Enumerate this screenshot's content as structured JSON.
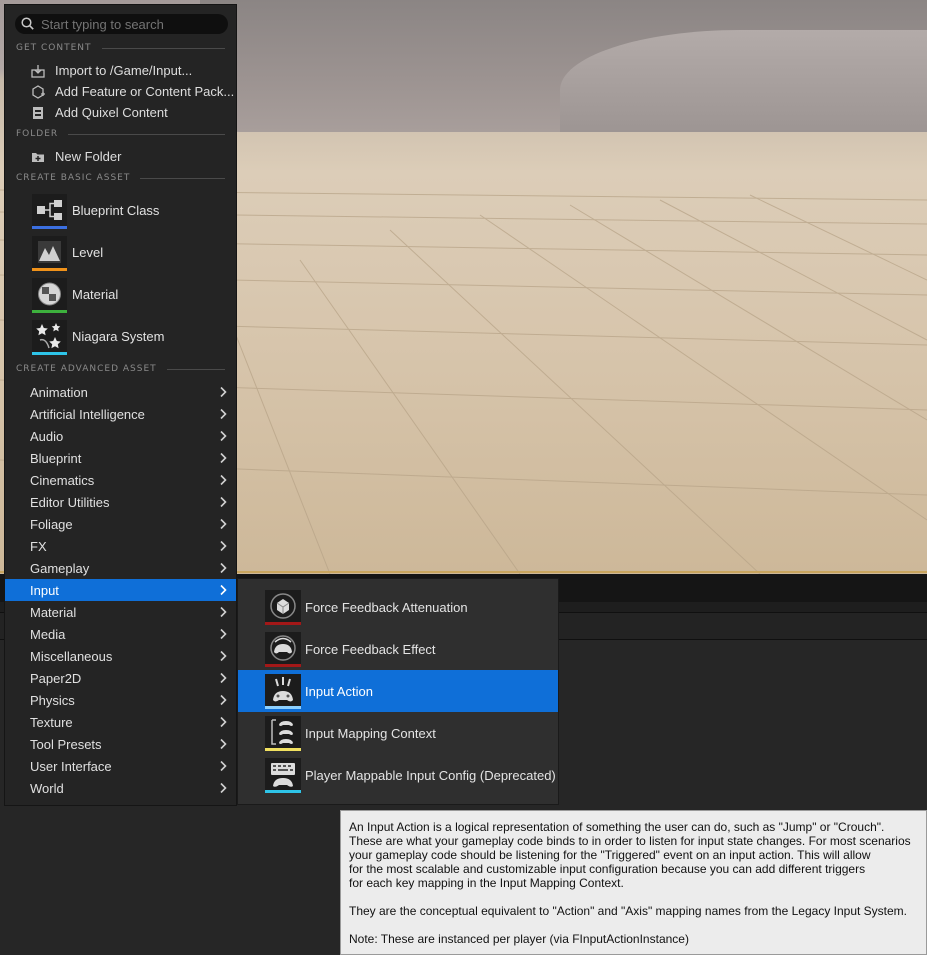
{
  "search": {
    "placeholder": "Start typing to search",
    "icon": "search-icon"
  },
  "sections": {
    "get_content": "GET CONTENT",
    "folder": "FOLDER",
    "create_basic": "CREATE BASIC ASSET",
    "create_advanced": "CREATE ADVANCED ASSET"
  },
  "get_content_items": [
    {
      "label": "Import to /Game/Input...",
      "icon": "import-icon"
    },
    {
      "label": "Add Feature or Content Pack...",
      "icon": "add-feature-icon"
    },
    {
      "label": "Add Quixel Content",
      "icon": "quixel-icon"
    }
  ],
  "folder_items": [
    {
      "label": "New Folder",
      "icon": "new-folder-icon"
    }
  ],
  "basic_assets": [
    {
      "label": "Blueprint Class",
      "icon": "blueprint-class-icon",
      "color": "#3b6fe0"
    },
    {
      "label": "Level",
      "icon": "level-icon",
      "color": "#f0921a"
    },
    {
      "label": "Material",
      "icon": "material-icon",
      "color": "#3db13d"
    },
    {
      "label": "Niagara System",
      "icon": "niagara-icon",
      "color": "#2ec4e8"
    }
  ],
  "categories": [
    "Animation",
    "Artificial Intelligence",
    "Audio",
    "Blueprint",
    "Cinematics",
    "Editor Utilities",
    "Foliage",
    "FX",
    "Gameplay",
    "Input",
    "Material",
    "Media",
    "Miscellaneous",
    "Paper2D",
    "Physics",
    "Texture",
    "Tool Presets",
    "User Interface",
    "World"
  ],
  "active_category": "Input",
  "submenu": [
    {
      "label": "Force Feedback Attenuation",
      "icon": "force-feedback-attenuation-icon",
      "color": "#a31818"
    },
    {
      "label": "Force Feedback Effect",
      "icon": "force-feedback-effect-icon",
      "color": "#a31818"
    },
    {
      "label": "Input Action",
      "icon": "input-action-icon",
      "color": "#8cd0ff"
    },
    {
      "label": "Input Mapping Context",
      "icon": "input-mapping-context-icon",
      "color": "#f0e060"
    },
    {
      "label": "Player Mappable Input Config (Deprecated)",
      "icon": "player-mappable-config-icon",
      "color": "#2ec4e8"
    }
  ],
  "active_submenu": "Input Action",
  "tooltip": {
    "para1": "An Input Action is a logical representation of something the user can do, such as \"Jump\" or \"Crouch\".\nThese are what your gameplay code binds to in order to listen for input state changes. For most scenarios\nyour gameplay code should be listening for the \"Triggered\" event on an input action. This will allow\nfor the most scalable and customizable input configuration because you can add different triggers\nfor each key mapping in the Input Mapping Context.",
    "para2": "They are the conceptual equivalent to \"Action\" and \"Axis\" mapping names from the Legacy Input System.",
    "para3": "Note: These are instanced per player (via FInputActionInstance)"
  },
  "colors": {
    "accent": "#0f6fd8",
    "menu_bg": "#242424",
    "tooltip_bg": "#ececec"
  }
}
